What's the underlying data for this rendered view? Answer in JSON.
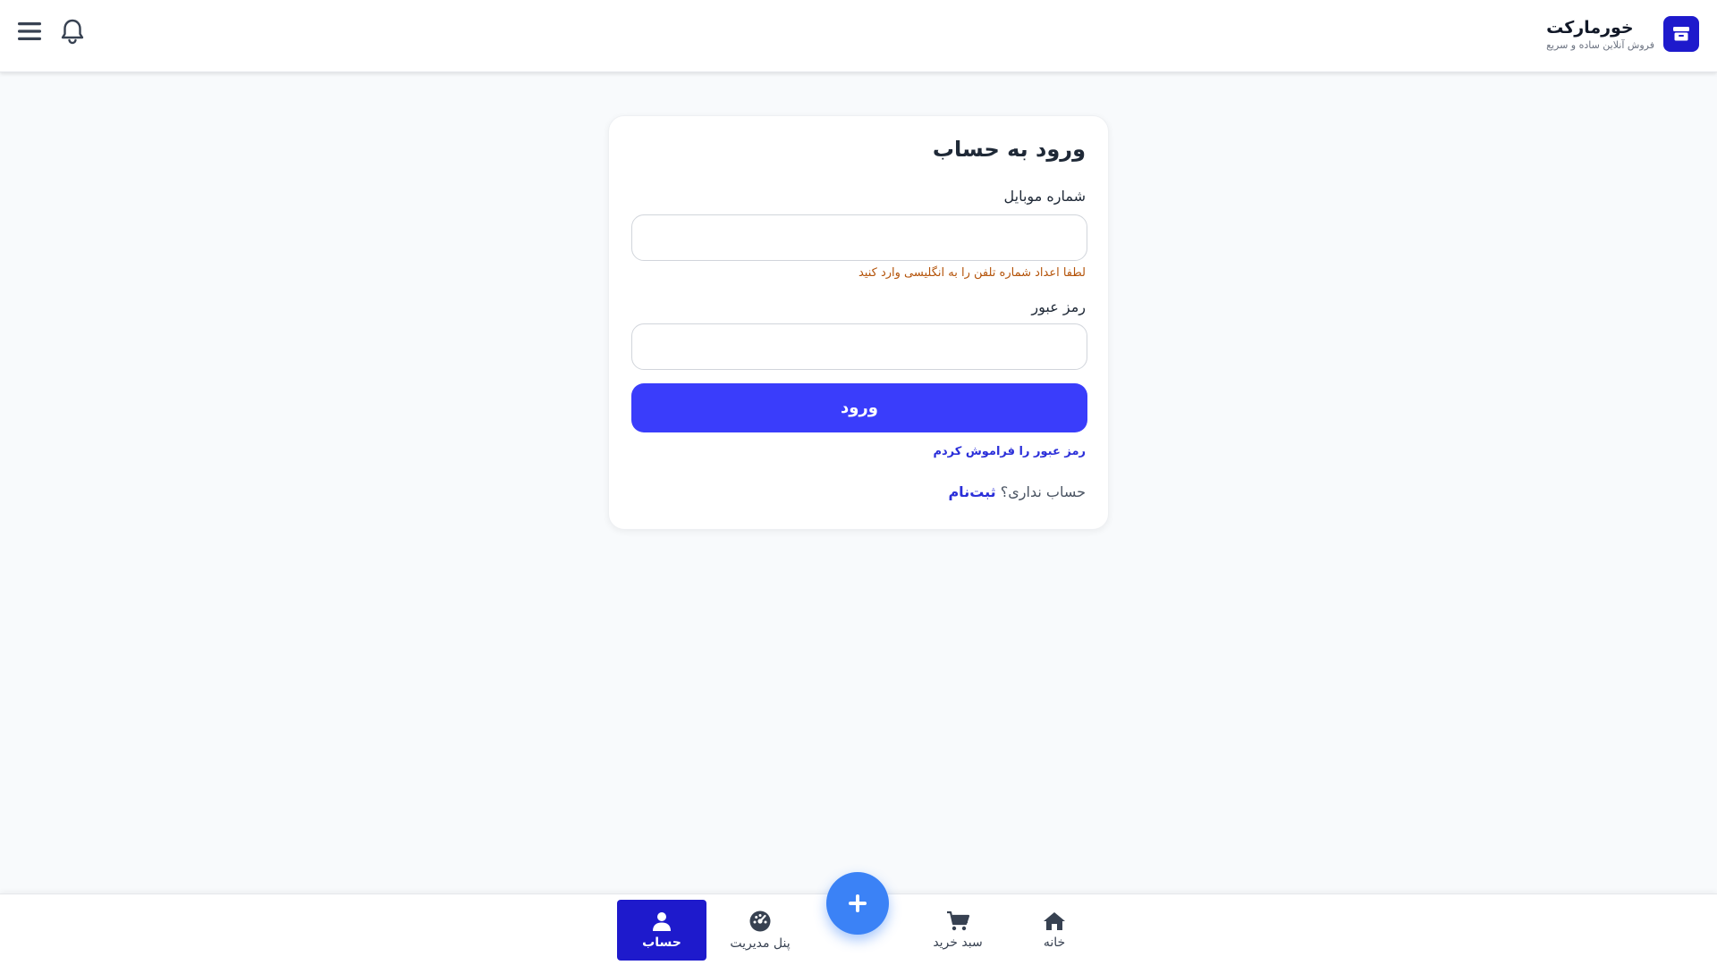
{
  "header": {
    "brand_name": "خورمارکت",
    "brand_tagline": "فروش آنلاین ساده و سریع",
    "menu_icon": "hamburger-menu-icon",
    "notification_icon": "bell-icon",
    "logo_icon": "store-icon"
  },
  "login": {
    "title": "ورود به حساب",
    "mobile_label": "شماره موبایل",
    "mobile_value": "",
    "mobile_hint": "لطفا اعداد شماره تلفن را به انگلیسی وارد کنید",
    "password_label": "رمز عبور",
    "password_value": "",
    "submit_label": "ورود",
    "forgot_label": "رمز عبور را فراموش کردم",
    "no_account_text": "حساب نداری؟",
    "register_label": "ثبت‌نام"
  },
  "bottom_nav": {
    "home_label": "خانه",
    "cart_label": "سبد خرید",
    "admin_label": "پنل مدیریت",
    "account_label": "حساب",
    "active_item": "حساب",
    "fab_icon": "plus-icon"
  },
  "colors": {
    "primary": "#1e1acc",
    "button": "#3a3dfb",
    "fab": "#3b82f6",
    "hint": "#b45309",
    "link": "#2b2fd9"
  }
}
